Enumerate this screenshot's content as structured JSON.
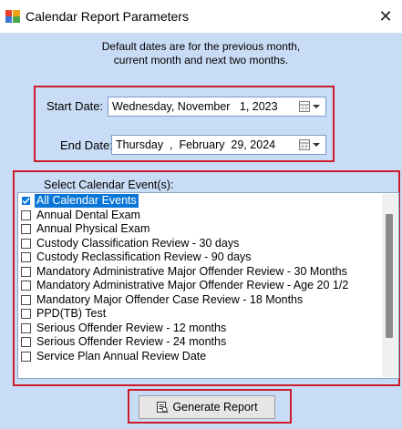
{
  "window": {
    "title": "Calendar Report Parameters",
    "close_glyph": "✕"
  },
  "info": {
    "line1": "Default dates are for the previous month,",
    "line2": "current month and next two months."
  },
  "dates": {
    "start_label": "Start Date:",
    "start_value": "Wednesday, November   1, 2023",
    "end_label": "End Date:",
    "end_value": "Thursday  ,  February  29, 2024"
  },
  "events": {
    "label": "Select Calendar Event(s):",
    "items": [
      {
        "label": "All Calendar Events",
        "checked": true,
        "selected": true
      },
      {
        "label": "Annual Dental Exam",
        "checked": false
      },
      {
        "label": "Annual Physical Exam",
        "checked": false
      },
      {
        "label": "Custody Classification Review - 30 days",
        "checked": false
      },
      {
        "label": "Custody Reclassification Review - 90 days",
        "checked": false
      },
      {
        "label": "Mandatory Administrative Major Offender Review - 30 Months",
        "checked": false
      },
      {
        "label": "Mandatory Administrative Major Offender Review - Age 20 1/2",
        "checked": false
      },
      {
        "label": "Mandatory Major Offender Case Review - 18 Months",
        "checked": false
      },
      {
        "label": "PPD(TB) Test",
        "checked": false
      },
      {
        "label": "Serious Offender Review - 12 months",
        "checked": false
      },
      {
        "label": "Serious Offender Review - 24 months",
        "checked": false
      },
      {
        "label": "Service Plan Annual Review Date",
        "checked": false
      }
    ]
  },
  "actions": {
    "generate_label": "Generate Report"
  },
  "icons": {
    "app": "app-window-icon",
    "calendar": "calendar-icon",
    "dropdown": "chevron-down-icon",
    "report": "report-icon"
  },
  "colors": {
    "window_bg": "#c9dcf5",
    "highlight": "#cc1b2b",
    "selection": "#0a77d8"
  }
}
